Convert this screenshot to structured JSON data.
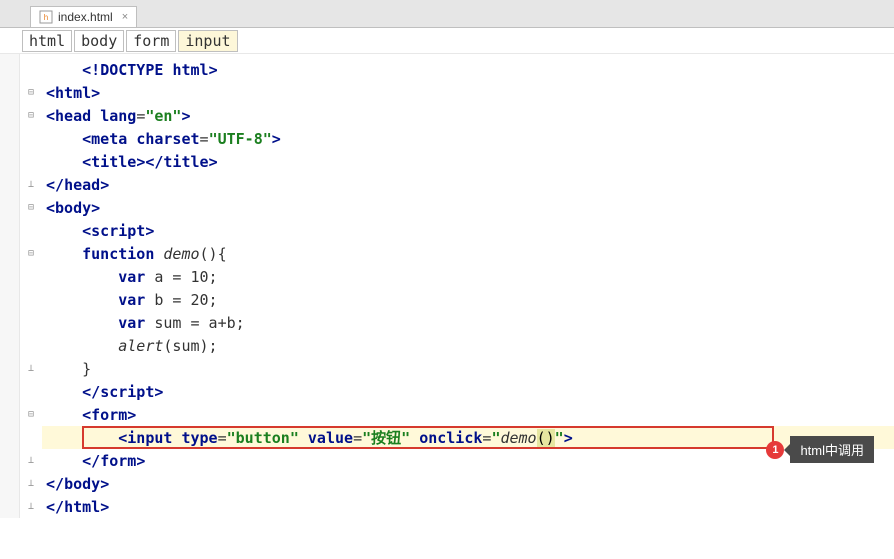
{
  "tab": {
    "label": "index.html",
    "close": "×"
  },
  "breadcrumb": [
    "html",
    "body",
    "form",
    "input"
  ],
  "tooltip": {
    "num": "1",
    "text": "html中调用"
  },
  "code": {
    "l1": {
      "indent": "    ",
      "open": "<!",
      "tag": "DOCTYPE",
      "sp": " ",
      "attr": "html",
      "close": ">"
    },
    "l2": {
      "open": "<",
      "tag": "html",
      "close": ">"
    },
    "l3": {
      "open": "<",
      "tag": "head",
      "sp": " ",
      "attr": "lang",
      "eq": "=",
      "val": "\"en\"",
      "close": ">"
    },
    "l4": {
      "indent": "    ",
      "open": "<",
      "tag": "meta",
      "sp": " ",
      "attr": "charset",
      "eq": "=",
      "val": "\"UTF-8\"",
      "close": ">"
    },
    "l5": {
      "indent": "    ",
      "open1": "<",
      "tag1": "title",
      "close1": ">",
      "open2": "</",
      "tag2": "title",
      "close2": ">"
    },
    "l6": {
      "open": "</",
      "tag": "head",
      "close": ">"
    },
    "l7": {
      "open": "<",
      "tag": "body",
      "close": ">"
    },
    "l8": {
      "indent": "    ",
      "open": "<",
      "tag": "script",
      "close": ">"
    },
    "l9": {
      "indent": "    ",
      "kw": "function",
      "sp": " ",
      "fn": "demo",
      "paren": "(){"
    },
    "l10": {
      "indent": "        ",
      "kw": "var",
      "rest": " a = 10;"
    },
    "l11": {
      "indent": "        ",
      "kw": "var",
      "rest": " b = 20;"
    },
    "l12": {
      "indent": "        ",
      "kw": "var",
      "rest": " sum = a+b;"
    },
    "l13": {
      "indent": "        ",
      "fn": "alert",
      "rest": "(sum);"
    },
    "l14": {
      "indent": "    ",
      "brace": "}"
    },
    "l15": {
      "indent": "    ",
      "open": "</",
      "tag": "script",
      "close": ">"
    },
    "l16": {
      "indent": "    ",
      "open": "<",
      "tag": "form",
      "close": ">"
    },
    "l17": {
      "indent": "        ",
      "open": "<",
      "tag": "input",
      "sp1": " ",
      "a1": "type",
      "eq1": "=",
      "v1": "\"button\"",
      "sp2": " ",
      "a2": "value",
      "eq2": "=",
      "v2": "\"按钮\"",
      "sp3": " ",
      "a3": "onclick",
      "eq3": "=",
      "q1": "\"",
      "fn": "demo",
      "p1": "(",
      "p2": ")",
      "q2": "\"",
      "close": ">"
    },
    "l18": {
      "indent": "    ",
      "open": "</",
      "tag": "form",
      "close": ">"
    },
    "l19": {
      "open": "</",
      "tag": "body",
      "close": ">"
    },
    "l20": {
      "open": "</",
      "tag": "html",
      "close": ">"
    }
  }
}
